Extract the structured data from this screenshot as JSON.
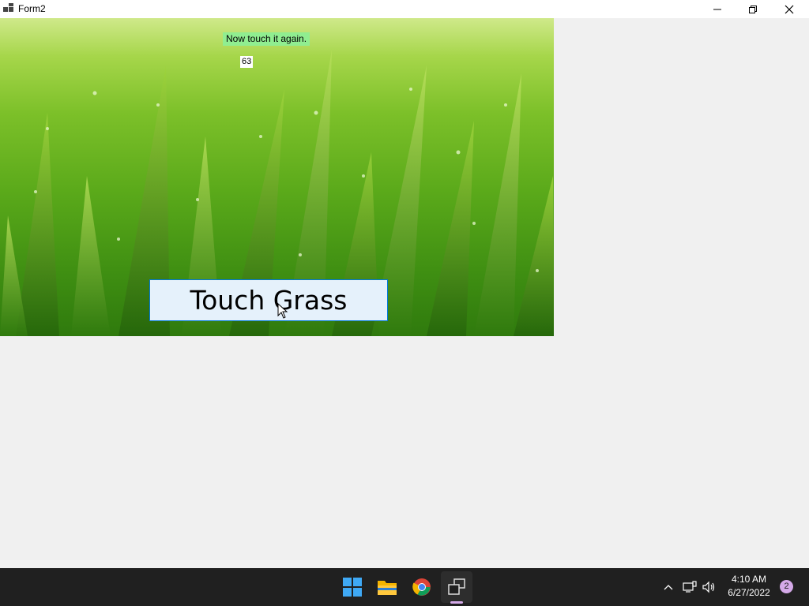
{
  "window": {
    "title": "Form2"
  },
  "form": {
    "message_label": "Now touch it again.",
    "counter_label": "63",
    "touch_button_label": "Touch Grass"
  },
  "taskbar": {
    "apps": [
      {
        "name": "start",
        "icon": "windows-start-icon"
      },
      {
        "name": "file-explorer",
        "icon": "folder-icon"
      },
      {
        "name": "chrome",
        "icon": "chrome-icon"
      },
      {
        "name": "form2",
        "icon": "app-window-icon",
        "active": true
      }
    ],
    "clock": {
      "time": "4:10 AM",
      "date": "6/27/2022"
    },
    "notification_count": "2"
  },
  "colors": {
    "message_background": "#90ee90",
    "button_background": "#e5f1fb",
    "button_border": "#0078d7",
    "taskbar": "#202020",
    "accent": "#d4a9e8"
  }
}
